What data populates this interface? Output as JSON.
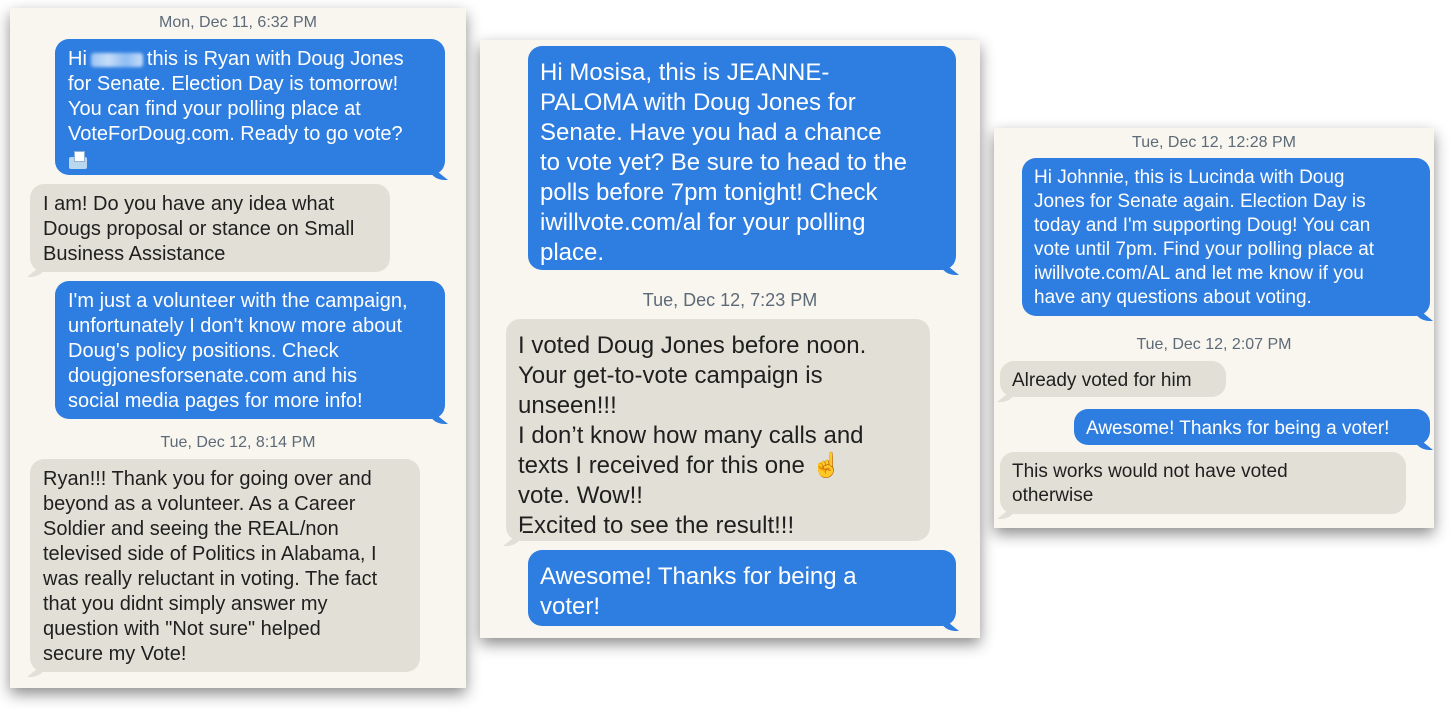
{
  "panel1": {
    "timestamp_1": "Mon, Dec 11, 6:32 PM",
    "msg1_pre": "Hi",
    "msg1_post": "this is Ryan with Doug Jones\nfor Senate. Election Day is tomorrow!\nYou can find your polling place at\nVoteForDoug.com. Ready to go vote?",
    "msg1_icon": "ballot-box-icon",
    "msg2": "I am! Do you have any idea what\nDougs proposal or stance on Small\nBusiness Assistance",
    "msg3": "I'm just a volunteer with the campaign,\nunfortunately I don't know more about\nDoug's policy positions. Check\ndougjonesforsenate.com and his\nsocial media pages for more info!",
    "timestamp_2": "Tue, Dec 12, 8:14 PM",
    "msg4": "Ryan!!! Thank you for going over and\nbeyond as a volunteer. As a Career\nSoldier and seeing the REAL/non\ntelevised side of Politics in Alabama,  I\nwas really reluctant in voting. The fact\nthat you didnt simply answer my\nquestion  with \"Not sure\" helped\nsecure my Vote!"
  },
  "panel2": {
    "msg1": "Hi  Mosisa, this is JEANNE-\nPALOMA with Doug Jones for\nSenate. Have you had a chance\nto vote yet? Be sure to head to the\npolls before 7pm tonight! Check\niwillvote.com/al for your polling\nplace.",
    "timestamp_1": "Tue, Dec 12, 7:23 PM",
    "msg2_part1": "I voted Doug Jones before noon.\nYour get-to-vote campaign is\nunseen!!!\nI don’t know how many calls and\ntexts I received for this one ",
    "msg2_emoji": "☝",
    "msg2_part2": "\nvote. Wow!!\nExcited to see the result!!!",
    "msg3": "Awesome! Thanks for being a\nvoter!"
  },
  "panel3": {
    "timestamp_1": "Tue, Dec 12, 12:28 PM",
    "msg1": "Hi  Johnnie, this is Lucinda with Doug\nJones for Senate again. Election Day is\ntoday and I'm supporting Doug! You can\nvote until 7pm. Find your polling place at\niwillvote.com/AL and let me know if you\nhave any questions about voting.",
    "timestamp_2": "Tue, Dec 12, 2:07 PM",
    "msg2": "Already voted for him",
    "msg3": "Awesome! Thanks for being a voter!",
    "msg4": "This works would not have voted\notherwise"
  },
  "colors": {
    "outgoing_bubble": "#2e7de0",
    "incoming_bubble": "#e2e0d6",
    "panel_background": "#f8f6ee",
    "timestamp_text": "#5d6a78"
  }
}
